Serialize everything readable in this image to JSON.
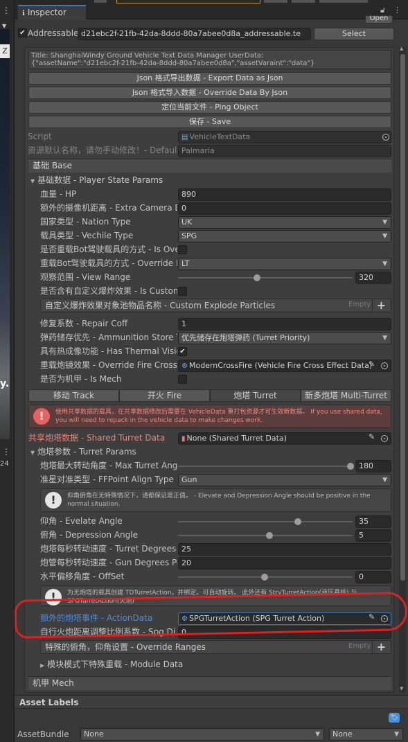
{
  "left_strip": {
    "label_z": "Z",
    "label_y": "y.",
    "label_24": "24"
  },
  "tab": {
    "title": "Inspector"
  },
  "header": {
    "open_button": "Open",
    "addressable_label": "Addressable",
    "addressable_checked": true,
    "addressable_value": "d21ebc2f-21fb-42da-8ddd-80a7abee0d8a_addressable.te",
    "select_button": "Select"
  },
  "userdata_title": {
    "line1": "Title: ShanghaiWindy Ground Vehicle Text Data Manager UserData:",
    "line2": "{\"assetName\":\"d21ebc2f-21fb-42da-8ddd-80a7abee0d8a\",\"assetVaraint\":\"data\"}"
  },
  "actions": {
    "export_json": "Json 格式导出数据 - Export Data as Json",
    "import_json": "Json 格式导入数据 - Override Data By Json",
    "ping": "定位当前文件 - Ping Object",
    "save": "保存 - Save"
  },
  "script": {
    "label": "Script",
    "value": "VehicleTextData"
  },
  "default_name": {
    "label": "资源默认名称，请勿手动修改！- Defaul",
    "value": "Palmaria"
  },
  "section_base": "基础 Base",
  "player_state": {
    "foldout": "基础数据 - Player State Params",
    "hp_label": "血量 - HP",
    "hp_value": "890",
    "camera_label": "额外的摄像机距离 - Extra Camera D",
    "camera_value": "0",
    "nation_label": "国家类型 - Nation Type",
    "nation_value": "UK",
    "vehicle_type_label": "载具类型 - Vechile Type",
    "vehicle_type_value": "SPG",
    "bot_label": "是否重载Bot驾驶载具的方式 - Is Ove",
    "override_bot_label": "重载Bot驾驶载具的方式 - Override E",
    "override_bot_value": "LT",
    "view_range_label": "观察范围 - View Range",
    "view_range_value": "320",
    "view_range_fraction": 0.49,
    "custom_explode_label": "是否含有自定义爆炸效果 - Is Custon",
    "explode_list_label": "自定义爆炸效果对象池物品名称 - Custom Explode Particles",
    "explode_list_empty": "Empty",
    "repair_label": "修复系数 - Repair Coff",
    "repair_value": "1",
    "ammo_label": "弹药储存优先 - Ammunition Store T",
    "ammo_value": "优先储存在炮塔弹药 (Turret Priority)",
    "thermal_label": "具有热成像功能 - Has Thermal Visic",
    "thermal_checked": true,
    "fire_cross_label": "重载炮镜效果 - Override Fire Cross",
    "fire_cross_value": "ModernCrossFire (Vehicle Fire Cross Effect Data)",
    "mech_label": "是否为机甲 - Is Mech"
  },
  "subtabs": [
    "移动 Track",
    "开火 Fire",
    "炮塔 Turret",
    "新多炮塔 Multi-Turret"
  ],
  "turret": {
    "warning": "使用共享数据的载具，在共享数据修改后需要在 VehicleData 重打包资源才可生效新数据。 If you use shared data, you will need to repack in the vehicle data to make changes work.",
    "shared_label": "共享炮塔数据 - Shared Turret Data",
    "shared_value": "None (Shared Turret Data)",
    "params_foldout": "炮塔参数 - Turret Params",
    "max_angle_label": "炮塔最大转动角度 - Max Turret Ang",
    "max_angle_value": "180",
    "max_angle_fraction": 1.0,
    "ffpoint_label": "准星对准类型 - FFPoint Align Type",
    "ffpoint_value": "Gun",
    "angle_info": "仰角俯角在无特殊情况下，请都保证是正值。 - Elevate and Depression Angle should be positive in the normal situation.",
    "elevate_label": "仰角 - Evelate Angle",
    "elevate_value": "35",
    "elevate_fraction": 0.7,
    "depression_label": "俯角 - Depression Angle",
    "depression_value": "5",
    "depression_fraction": 0.53,
    "turret_deg_label": "炮塔每秒转动速度 - Turret Degrees",
    "turret_deg_value": "25",
    "gun_deg_label": "炮管每秒转动速度 - Gun Degrees Pe",
    "gun_deg_value": "20",
    "offset_label": "水平偏移角度 - OffSet",
    "offset_value": "0",
    "offset_fraction": 0.5,
    "action_info": "为无炮塔的载具创建 TDTurretAction，并绑定。可自动旋转。 此外还有 StrvTurretAction(液压悬挂) 与 SPGTurretAction(火炮)",
    "action_label": "额外的炮塔事件 - ActionData",
    "action_value": "SPGTurretAction (SPG Turret Action)",
    "auto_dist_label": "自行火炮距离调整比例系数 - Spg Di",
    "auto_dist_value": "0",
    "override_ranges_label": "特殊的俯角，仰角设置 - Override Ranges",
    "override_ranges_empty": "Empty",
    "module_data": "模块模式下特殊重载 - Module Data"
  },
  "section_mech": "机甲 Mech",
  "asset_labels": "Asset Labels",
  "asset_bundle": {
    "label": "AssetBundle",
    "value1": "None",
    "value2": "None"
  }
}
